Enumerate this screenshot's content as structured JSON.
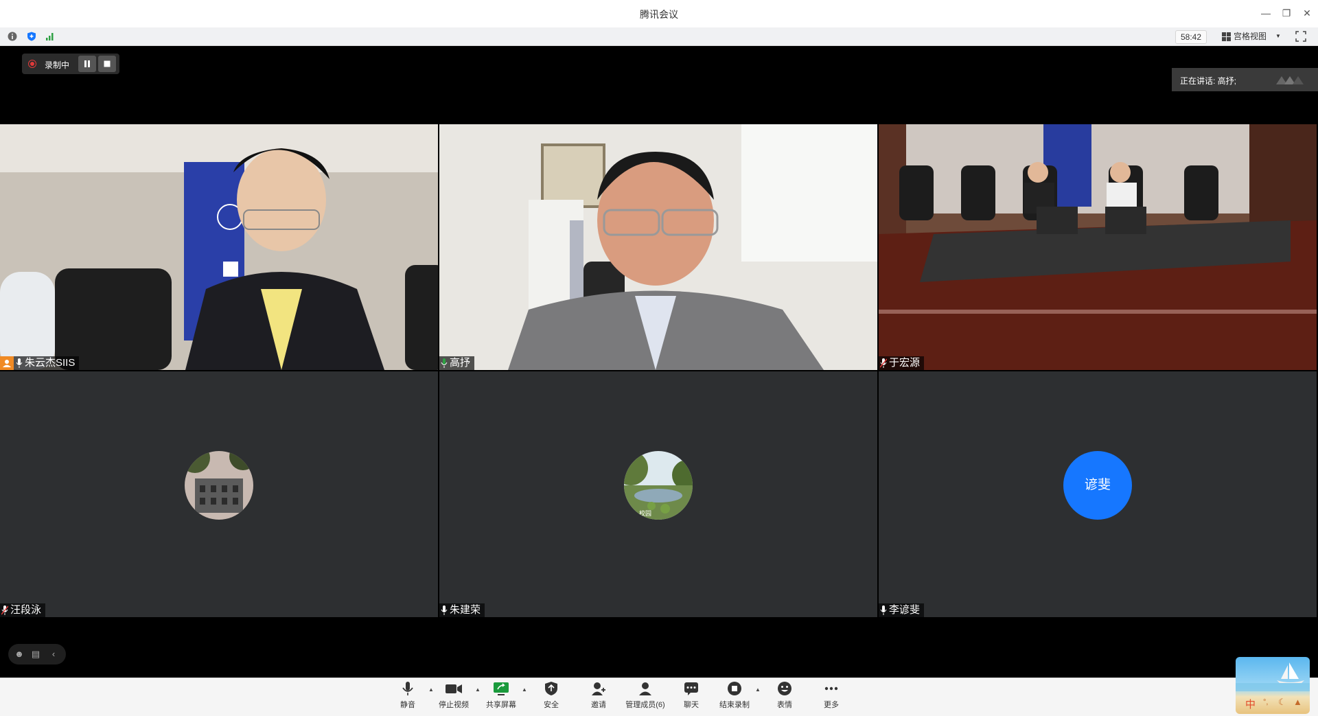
{
  "window": {
    "title": "腾讯会议",
    "minimize_icon": "minimize-icon",
    "restore_icon": "restore-icon",
    "close_icon": "close-icon"
  },
  "statusbar": {
    "info_icon": "info-icon",
    "security_icon": "shield-icon",
    "signal_icon": "signal-icon",
    "timer": "58:42",
    "view_mode": "宫格视图",
    "fullscreen_icon": "fullscreen-icon"
  },
  "recording": {
    "label": "录制中",
    "pause_icon": "pause-icon",
    "stop_icon": "stop-icon"
  },
  "speaking": {
    "label": "正在讲话: 高抒;"
  },
  "participants": [
    {
      "name": "朱云杰SIIS",
      "host": true,
      "video": true
    },
    {
      "name": "高抒",
      "video": true,
      "active": true
    },
    {
      "name": "于宏源",
      "video": true
    },
    {
      "name": "汪段泳",
      "video": false
    },
    {
      "name": "朱建荣",
      "video": false,
      "avatar_caption": "校园"
    },
    {
      "name": "李谚斐",
      "video": false,
      "avatar_text": "谚斐"
    }
  ],
  "colors": {
    "accent_green": "#2ea043",
    "avatar_blue": "#1677ff",
    "record_red": "#e23a3a",
    "host_orange": "#f08a24",
    "tile_bg": "#2d2f31"
  },
  "toolbar": {
    "mute": "静音",
    "stop_video": "停止视频",
    "share_screen": "共享屏幕",
    "security": "安全",
    "invite": "邀请",
    "manage_members": "管理成员(6)",
    "chat": "聊天",
    "end_recording": "结束录制",
    "reactions": "表情",
    "more": "更多"
  },
  "ime": {
    "label": "中"
  }
}
